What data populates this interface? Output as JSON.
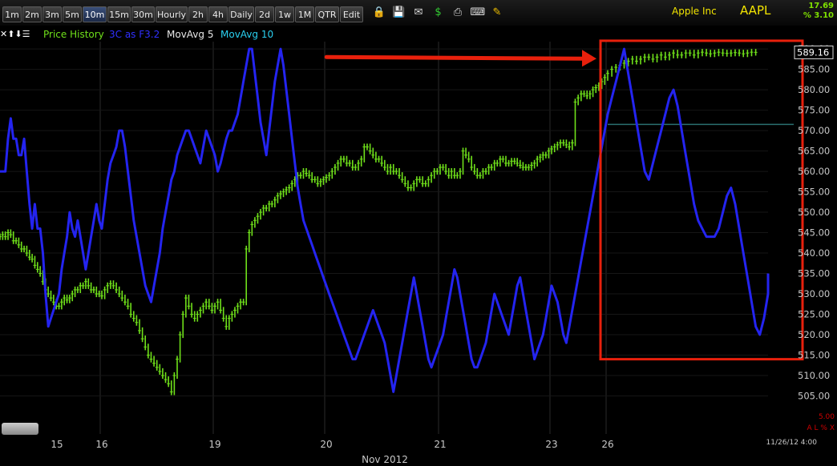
{
  "toolbar": {
    "timeframes": [
      {
        "label": "1m",
        "active": false
      },
      {
        "label": "2m",
        "active": false
      },
      {
        "label": "3m",
        "active": false
      },
      {
        "label": "5m",
        "active": false
      },
      {
        "label": "10m",
        "active": true
      },
      {
        "label": "15m",
        "active": false
      },
      {
        "label": "30m",
        "active": false
      },
      {
        "label": "Hourly",
        "active": false
      },
      {
        "label": "2h",
        "active": false
      },
      {
        "label": "4h",
        "active": false
      },
      {
        "label": "Daily",
        "active": false
      },
      {
        "label": "2d",
        "active": false
      },
      {
        "label": "1w",
        "active": false
      },
      {
        "label": "1M",
        "active": false
      },
      {
        "label": "QTR",
        "active": false
      },
      {
        "label": "Edit",
        "active": false
      }
    ],
    "tools": [
      "lock-icon",
      "save-icon",
      "mail-icon",
      "dollar-icon",
      "print-icon",
      "keyboard-icon",
      "pencil-icon"
    ],
    "company": "Apple Inc",
    "ticker": "AAPL",
    "change_value": "17.69",
    "change_percent": "% 3.10"
  },
  "legend": {
    "price_history": "Price History",
    "indicator": "3C as F3.2",
    "ma5": "MovAvg 5",
    "ma10": "MovAvg 10"
  },
  "bottom": {
    "month_label": "Nov 2012",
    "datetime": "11/26/12 4:00",
    "right_value": "5.00",
    "right_markers": "A L % X"
  },
  "colors": {
    "price": "#6fe01a",
    "indicator": "#2424f0",
    "annotation": "#e8200c",
    "axis_text": "#c8c8c8",
    "highlight": "#ffd700"
  },
  "chart_data": {
    "type": "line",
    "xlabel": "Nov 2012",
    "ylabel": "",
    "ylim": [
      500,
      591
    ],
    "yticks": [
      505,
      510,
      515,
      520,
      525,
      530,
      535,
      540,
      545,
      550,
      555,
      560,
      565,
      570,
      575,
      580,
      585,
      590
    ],
    "ytick_labels": [
      "505.00",
      "510.00",
      "515.00",
      "520.00",
      "525.00",
      "530.00",
      "535.00",
      "540.00",
      "545.00",
      "550.00",
      "555.00",
      "560.00",
      "565.00",
      "570.00",
      "575.00",
      "580.00",
      "585.00",
      "590.00"
    ],
    "last_price": "589.16",
    "last_price_value": 589.16,
    "reference_level": 571.5,
    "sessions": [
      {
        "label": "15",
        "start": 0,
        "end": 38
      },
      {
        "label": "16",
        "start": 38,
        "end": 77
      },
      {
        "label": "19",
        "start": 77,
        "end": 116
      },
      {
        "label": "20",
        "start": 116,
        "end": 155
      },
      {
        "label": "21",
        "start": 155,
        "end": 194
      },
      {
        "label": "23",
        "start": 194,
        "end": 213
      },
      {
        "label": "26",
        "start": 213,
        "end": 252
      }
    ],
    "x_range": [
      0,
      252
    ],
    "series": [
      {
        "name": "Price History",
        "values": [
          544,
          544.5,
          544,
          545,
          544.5,
          543,
          543,
          542,
          541,
          541,
          540,
          539,
          538.5,
          537,
          536,
          535,
          533,
          531,
          530,
          529,
          528,
          527,
          527,
          528,
          529,
          528.5,
          529,
          530,
          531,
          531,
          532,
          532,
          533,
          532,
          531,
          531,
          530,
          530,
          529.5,
          531,
          532,
          532.5,
          532,
          531,
          530,
          529,
          528,
          527,
          525,
          524,
          523,
          521,
          519,
          517,
          515,
          514,
          513,
          512,
          511,
          510,
          509,
          508,
          506,
          510,
          514,
          520,
          525,
          529,
          527,
          525,
          524,
          525,
          526,
          527,
          528,
          527,
          526,
          527,
          528,
          526,
          524,
          522,
          524,
          525,
          526,
          527,
          528,
          528,
          541,
          545,
          547,
          548,
          549,
          550,
          551,
          551,
          552,
          552,
          553,
          554,
          554.5,
          555,
          555.5,
          556,
          557,
          558,
          559,
          559,
          560,
          559.5,
          559,
          558,
          558,
          557,
          557.5,
          558,
          558.5,
          559,
          560,
          561,
          562,
          563,
          563,
          562,
          562,
          561,
          561,
          562,
          563,
          566,
          566,
          565,
          564,
          563,
          563,
          562,
          561,
          560,
          561,
          560,
          560,
          559,
          558,
          557,
          556,
          556,
          557,
          558,
          558,
          557,
          557,
          558,
          559,
          560,
          560,
          561,
          561,
          560,
          559,
          560,
          559,
          559,
          560,
          565,
          564,
          563,
          561,
          560,
          559,
          559,
          560,
          560,
          561,
          561,
          562,
          562,
          563,
          563,
          562,
          562,
          562.5,
          562.5,
          562,
          561.5,
          561,
          561,
          561,
          561.5,
          562,
          563,
          563.5,
          564,
          564,
          565,
          565.5,
          566,
          566.5,
          567,
          567,
          566.5,
          566,
          567,
          577,
          578,
          579,
          579,
          578.5,
          579,
          580,
          580.5,
          581,
          582,
          583,
          584,
          585,
          585.5,
          586,
          586.5,
          587,
          587.5,
          587,
          587.5,
          588,
          588,
          587.5,
          588,
          588.5,
          588,
          588.5,
          589,
          588.5,
          588.5,
          589,
          589,
          588.5,
          589,
          589.2,
          589,
          588.8,
          589,
          589.2,
          589,
          588.9,
          589,
          589.1,
          589,
          588.8,
          589,
          589.2,
          589.16
        ],
        "color": "#6fe01a"
      },
      {
        "name": "3C as F3.2",
        "values": [
          560,
          560,
          560,
          568,
          573,
          568,
          568,
          564,
          564,
          568,
          560,
          552,
          546,
          552,
          546,
          546,
          540,
          530,
          522,
          524,
          526,
          528,
          530,
          536,
          540,
          544,
          550,
          546,
          544,
          548,
          544,
          540,
          536,
          540,
          544,
          548,
          552,
          548,
          546,
          552,
          558,
          562,
          564,
          566,
          570,
          570,
          566,
          560,
          554,
          548,
          544,
          540,
          536,
          532,
          530,
          528,
          532,
          536,
          540,
          546,
          550,
          554,
          558,
          560,
          564,
          566,
          568,
          570,
          570,
          568,
          566,
          564,
          562,
          566,
          570,
          568,
          566,
          564,
          560,
          562,
          565,
          568,
          570,
          570,
          572,
          574,
          578,
          582,
          586,
          590,
          590,
          584,
          578,
          572,
          568,
          564,
          570,
          576,
          582,
          586,
          590,
          586,
          580,
          574,
          568,
          562,
          556,
          552,
          548,
          546,
          544,
          542,
          540,
          538,
          536,
          534,
          532,
          530,
          528,
          526,
          524,
          522,
          520,
          518,
          516,
          514,
          514,
          516,
          518,
          520,
          522,
          524,
          526,
          524,
          522,
          520,
          518,
          514,
          510,
          506,
          510,
          514,
          518,
          522,
          526,
          530,
          534,
          530,
          526,
          522,
          518,
          514,
          512,
          514,
          516,
          518,
          520,
          524,
          528,
          532,
          536,
          534,
          530,
          526,
          522,
          518,
          514,
          512,
          512,
          514,
          516,
          518,
          522,
          526,
          530,
          528,
          526,
          524,
          522,
          520,
          524,
          528,
          532,
          534,
          530,
          526,
          522,
          518,
          514,
          516,
          518,
          520,
          524,
          528,
          532,
          530,
          528,
          524,
          520,
          518,
          522,
          526,
          530,
          534,
          538,
          542,
          546,
          550,
          554,
          558,
          562,
          566,
          570,
          574,
          578,
          582,
          586,
          590,
          584,
          578,
          572,
          566,
          560,
          558,
          562,
          566,
          570,
          574,
          578,
          580,
          576,
          570,
          564,
          558,
          552,
          548,
          546,
          544,
          544,
          544,
          546,
          550,
          554,
          556,
          552,
          546,
          540,
          534,
          528,
          522,
          520,
          524,
          530,
          535
        ],
        "color": "#2424f0"
      }
    ],
    "annotations": {
      "highlight_box": {
        "x_start": 213,
        "x_end": 252,
        "y_min": 514,
        "y_max": 592
      },
      "arrow": {
        "label": "",
        "from_x": 88,
        "to_x": 211,
        "y": 588
      }
    }
  }
}
